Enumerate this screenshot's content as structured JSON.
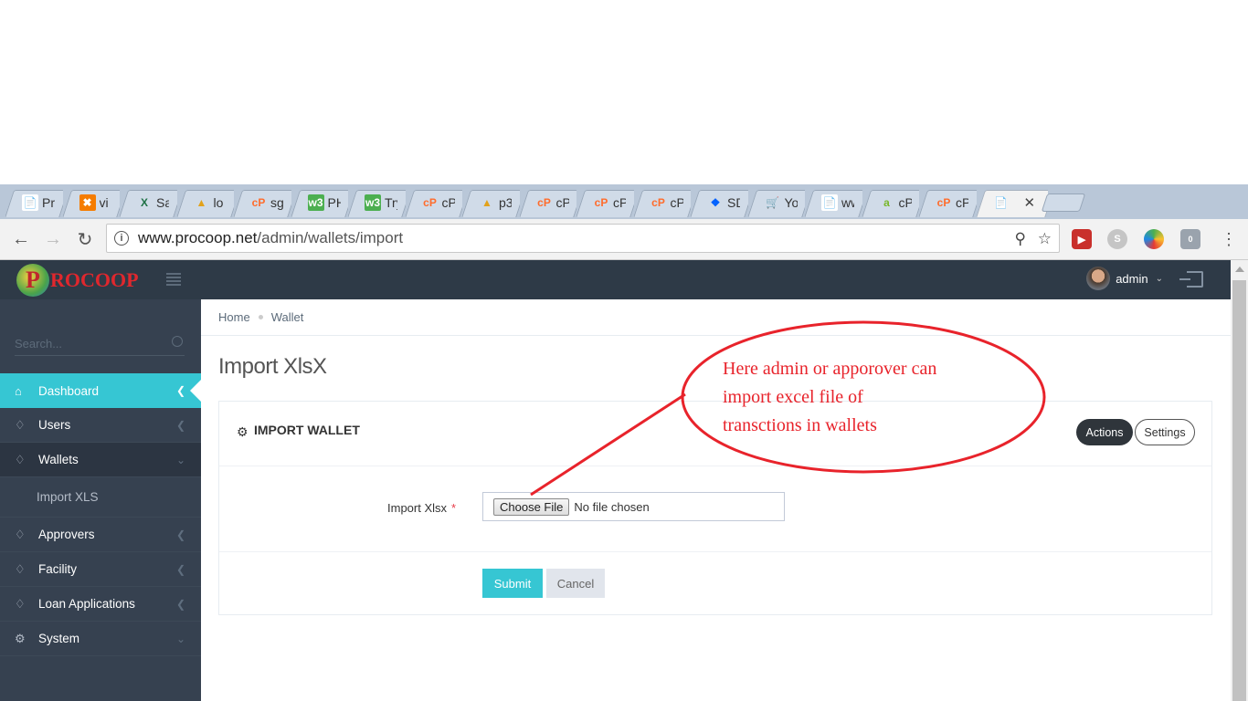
{
  "browser": {
    "tabs": [
      {
        "title": "Pr",
        "icon": "document-icon"
      },
      {
        "title": "vi",
        "icon": "xampp-icon"
      },
      {
        "title": "Sa",
        "icon": "excel-icon"
      },
      {
        "title": "lo",
        "icon": "phpmyadmin-icon"
      },
      {
        "title": "sg",
        "icon": "cpanel-icon"
      },
      {
        "title": "PH",
        "icon": "w3schools-icon"
      },
      {
        "title": "Try",
        "icon": "w3schools-icon"
      },
      {
        "title": "cP",
        "icon": "cpanel-icon"
      },
      {
        "title": "p3",
        "icon": "phpmyadmin-icon"
      },
      {
        "title": "cP",
        "icon": "cpanel-icon"
      },
      {
        "title": "cP",
        "icon": "cpanel-icon"
      },
      {
        "title": "cP",
        "icon": "cpanel-icon"
      },
      {
        "title": "SD",
        "icon": "dropbox-icon"
      },
      {
        "title": "Yo",
        "icon": "cart-icon"
      },
      {
        "title": "ww",
        "icon": "document-icon"
      },
      {
        "title": "cP",
        "icon": "green-a-icon"
      },
      {
        "title": "cP",
        "icon": "cpanel-icon"
      }
    ],
    "active_tab_icon": "document-icon",
    "url_host": "www.procoop.net",
    "url_path": "/admin/wallets/import",
    "extension_badge": "0"
  },
  "app": {
    "logo_text": "ROCOOP",
    "logo_letter": "P",
    "user_name": "admin",
    "search_placeholder": "Search...",
    "menu": [
      {
        "label": "Dashboard",
        "icon": "home-icon",
        "state": "active"
      },
      {
        "label": "Users",
        "icon": "diamond-icon",
        "state": "collapsed"
      },
      {
        "label": "Wallets",
        "icon": "diamond-icon",
        "state": "open"
      },
      {
        "label": "Approvers",
        "icon": "diamond-icon",
        "state": "collapsed"
      },
      {
        "label": "Facility",
        "icon": "diamond-icon",
        "state": "collapsed"
      },
      {
        "label": "Loan Applications",
        "icon": "diamond-icon",
        "state": "collapsed"
      },
      {
        "label": "System",
        "icon": "gear-icon",
        "state": "open"
      }
    ],
    "submenu_wallets": [
      "Import XLS"
    ],
    "breadcrumb": [
      "Home",
      "Wallet"
    ],
    "page_title": "Import XlsX",
    "portlet": {
      "title": "IMPORT WALLET",
      "actions_label": "Actions",
      "settings_label": "Settings"
    },
    "form": {
      "label": "Import Xlsx",
      "required_mark": "*",
      "choose_file_label": "Choose File",
      "no_file_text": "No file chosen",
      "submit_label": "Submit",
      "cancel_label": "Cancel"
    }
  },
  "annotation": {
    "lines": [
      "Here admin or apporover can",
      "import excel file of",
      "transctions in wallets"
    ],
    "color": "#e8232b"
  },
  "colors": {
    "accent": "#36c6d3",
    "sidebar": "#364150",
    "topbar": "#2e3a47"
  }
}
